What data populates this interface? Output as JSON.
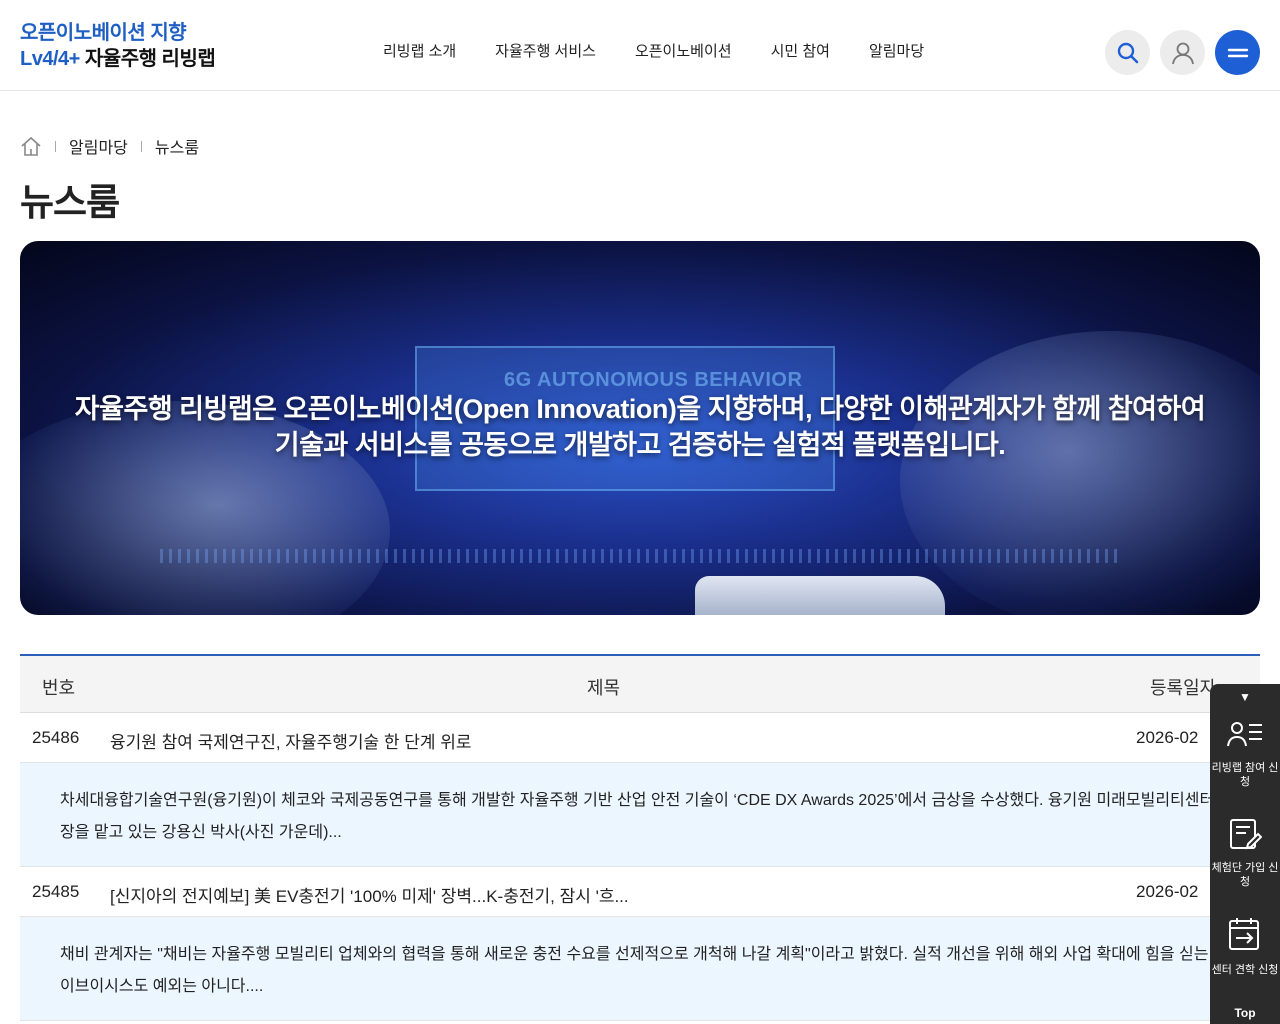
{
  "header": {
    "logo_line1": "오픈이노베이션 지향",
    "logo_line2_blue": "Lv4/4+",
    "logo_line2_dark": "자율주행 리빙랩",
    "nav": [
      "리빙랩 소개",
      "자율주행 서비스",
      "오픈이노베이션",
      "시민 참여",
      "알림마당"
    ],
    "icons": [
      "search-icon",
      "user-icon",
      "menu-icon"
    ]
  },
  "breadcrumb": {
    "home_icon": "home-icon",
    "items": [
      "알림마당",
      "뉴스룸"
    ]
  },
  "page_title": "뉴스룸",
  "banner": {
    "image_text": "6G AUTONOMOUS BEHAVIOR",
    "headline_line1": "자율주행 리빙랩은 오픈이노베이션(Open Innovation)을 지향하며, 다양한 이해관계자가 함께 참여하여",
    "headline_line2": "기술과 서비스를 공동으로 개발하고 검증하는 실험적 플랫폼입니다."
  },
  "table": {
    "headers": {
      "num": "번호",
      "title": "제목",
      "date": "등록일자"
    },
    "rows": [
      {
        "num": "25486",
        "title": "융기원 참여 국제연구진, 자율주행기술 한 단계 위로",
        "date": "2026-02",
        "summary": "차세대융합기술연구원(융기원)이 체코와 국제공동연구를 통해 개발한 자율주행 기반 산업 안전 기술이 ‘CDE DX Awards 2025’에서 금상을 수상했다. 융기원 미래모빌리티센터장을 맡고 있는 강용신 박사(사진 가운데)..."
      },
      {
        "num": "25485",
        "title": "[신지아의 전지예보] 美 EV충전기 '100% 미제' 장벽...K-충전기, 잠시 '흐...",
        "date": "2026-02",
        "summary": "채비 관계자는 \"채비는 자율주행 모빌리티 업체와의 협력을 통해 새로운 충전 수요를 선제적으로 개척해 나갈 계획\"이라고 밝혔다. 실적 개선을 위해 해외 사업 확대에 힘을 싣는 이브이시스도 예외는 아니다...."
      }
    ]
  },
  "quick_menu": {
    "items": [
      {
        "icon": "applicant-list-icon",
        "label": "리빙랩 참여 신청"
      },
      {
        "icon": "form-edit-icon",
        "label": "체험단 가입 신청"
      },
      {
        "icon": "calendar-visit-icon",
        "label": "센터 견학 신청"
      }
    ],
    "top_label": "Top"
  }
}
